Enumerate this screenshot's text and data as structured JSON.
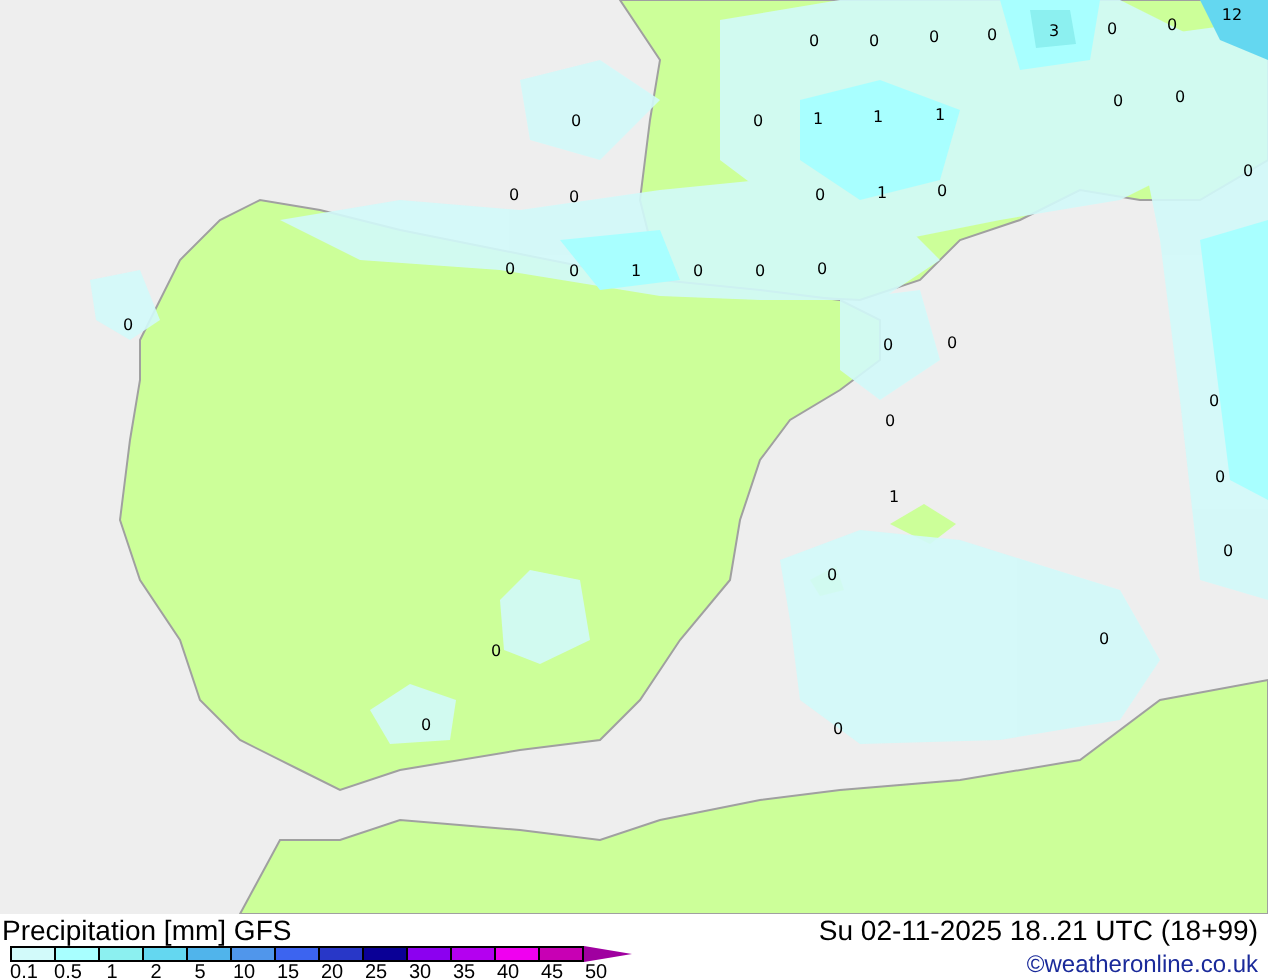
{
  "map": {
    "values": [
      "0",
      "0",
      "0",
      "0",
      "3",
      "0",
      "0",
      "12",
      "0",
      "0",
      "1",
      "1",
      "1",
      "0",
      "0",
      "0",
      "0",
      "0",
      "0",
      "1",
      "0",
      "0",
      "0",
      "1",
      "0",
      "0",
      "0",
      "0",
      "0",
      "0",
      "0",
      "0",
      "1",
      "0",
      "0",
      "0",
      "0",
      "0",
      "0",
      "0"
    ]
  },
  "legend": {
    "title": "Precipitation [mm] GFS",
    "swatches": [
      {
        "color": "#d2fafa"
      },
      {
        "color": "#a8ffff"
      },
      {
        "color": "#8cf0f0"
      },
      {
        "color": "#64d7f0"
      },
      {
        "color": "#50b4eb"
      },
      {
        "color": "#5096eb"
      },
      {
        "color": "#3c64f0"
      },
      {
        "color": "#2837c8"
      },
      {
        "color": "#0a0096"
      },
      {
        "color": "#8c00f0"
      },
      {
        "color": "#b400f0"
      },
      {
        "color": "#f000f0"
      },
      {
        "color": "#c800b4"
      }
    ],
    "ticks": [
      "0.1",
      "0.5",
      "1",
      "2",
      "5",
      "10",
      "15",
      "20",
      "25",
      "30",
      "35",
      "40",
      "45",
      "50"
    ]
  },
  "valid_time": "Su 02-11-2025 18..21 UTC (18+99)",
  "credit": "©weatheronline.co.uk"
}
